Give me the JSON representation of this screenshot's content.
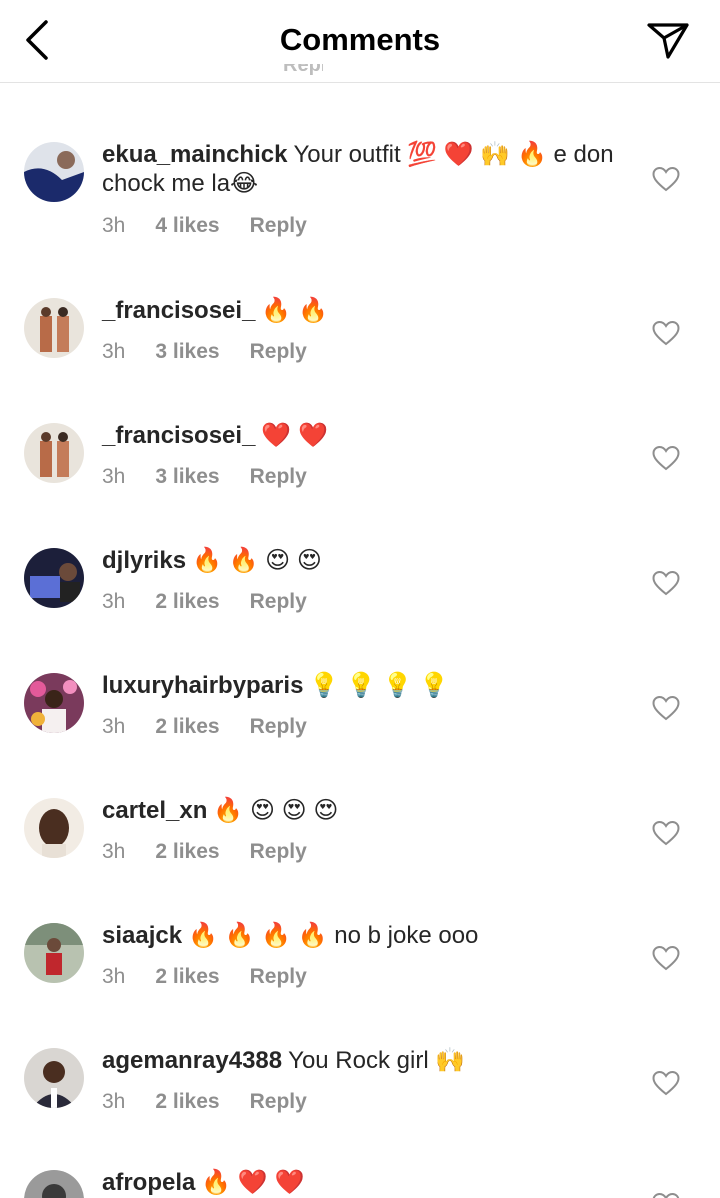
{
  "header": {
    "title": "Comments"
  },
  "partial_reply": "Reply",
  "comments": [
    {
      "username": "ekua_mainchick",
      "text": "Your outfit 💯 ❤️ 🙌 🔥 e don chock me la😂",
      "time": "3h",
      "likes": "4 likes",
      "reply": "Reply"
    },
    {
      "username": "_francisosei_",
      "text": "🔥 🔥",
      "time": "3h",
      "likes": "3 likes",
      "reply": "Reply"
    },
    {
      "username": "_francisosei_",
      "text": "❤️ ❤️",
      "time": "3h",
      "likes": "3 likes",
      "reply": "Reply"
    },
    {
      "username": "djlyriks",
      "text": "🔥 🔥 😍 😍",
      "time": "3h",
      "likes": "2 likes",
      "reply": "Reply"
    },
    {
      "username": "luxuryhairbyparis",
      "text": "💡 💡 💡 💡",
      "time": "3h",
      "likes": "2 likes",
      "reply": "Reply"
    },
    {
      "username": "cartel_xn",
      "text": "🔥 😍 😍 😍",
      "time": "3h",
      "likes": "2 likes",
      "reply": "Reply"
    },
    {
      "username": "siaajck",
      "text": "🔥 🔥 🔥 🔥  no b joke ooo",
      "time": "3h",
      "likes": "2 likes",
      "reply": "Reply"
    },
    {
      "username": "agemanray4388",
      "text": "You Rock girl 🙌",
      "time": "3h",
      "likes": "2 likes",
      "reply": "Reply"
    },
    {
      "username": "afropela",
      "text": "🔥 ❤️ ❤️",
      "time": "",
      "likes": "",
      "reply": ""
    }
  ],
  "colors": {
    "text": "#262626",
    "meta": "#8e8e8e",
    "divider": "#e3e3e3"
  }
}
